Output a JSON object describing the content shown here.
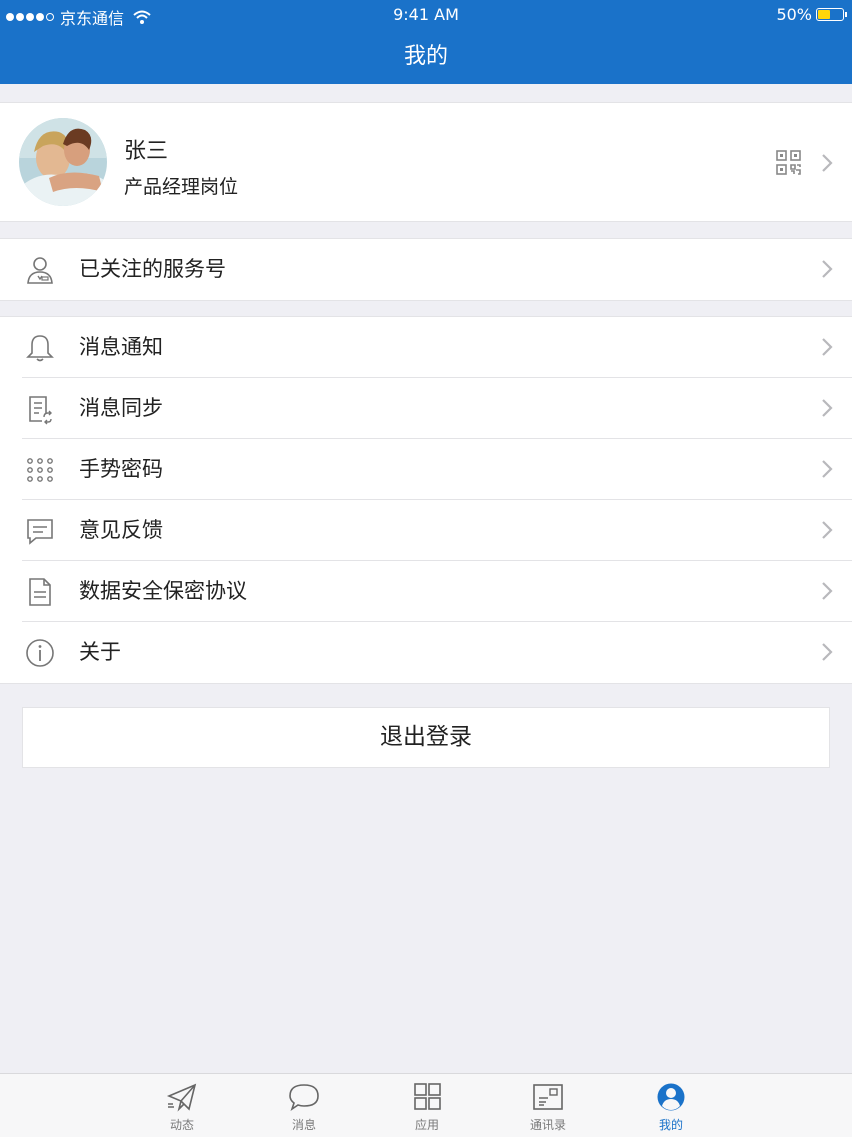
{
  "status_bar": {
    "carrier": "京东通信",
    "time": "9:41 AM",
    "battery": "50%"
  },
  "nav": {
    "title": "我的"
  },
  "profile": {
    "name": "张三",
    "position": "产品经理岗位"
  },
  "service_row": {
    "label": "已关注的服务号"
  },
  "menu": [
    {
      "label": "消息通知",
      "icon": "bell-icon"
    },
    {
      "label": "消息同步",
      "icon": "sync-doc-icon"
    },
    {
      "label": "手势密码",
      "icon": "gesture-dots-icon"
    },
    {
      "label": "意见反馈",
      "icon": "feedback-icon"
    },
    {
      "label": "数据安全保密协议",
      "icon": "document-icon"
    },
    {
      "label": "关于",
      "icon": "info-icon"
    }
  ],
  "logout": {
    "label": "退出登录"
  },
  "tabs": [
    {
      "label": "动态",
      "icon": "paper-plane-icon",
      "active": false
    },
    {
      "label": "消息",
      "icon": "chat-bubble-icon",
      "active": false
    },
    {
      "label": "应用",
      "icon": "grid-icon",
      "active": false
    },
    {
      "label": "通讯录",
      "icon": "contact-card-icon",
      "active": false
    },
    {
      "label": "我的",
      "icon": "user-icon",
      "active": true
    }
  ],
  "colors": {
    "brand": "#1a72c9",
    "background": "#efeff4",
    "battery_fill": "#ffd60a"
  }
}
